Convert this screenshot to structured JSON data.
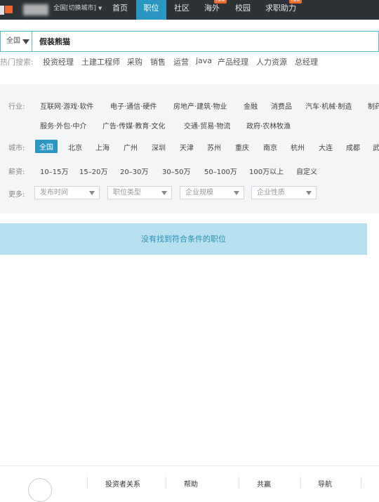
{
  "header": {
    "city_switch": "全国[切换城市]",
    "nav": [
      {
        "label": "首页"
      },
      {
        "label": "职位"
      },
      {
        "label": "社区"
      },
      {
        "label": "海外",
        "badge": "new"
      },
      {
        "label": "校园"
      },
      {
        "label": "求职助力",
        "badge": "new"
      }
    ],
    "active_nav": "职位",
    "accent_color": "#2a97c2",
    "badge_color": "#f06a2c"
  },
  "search": {
    "scope_label": "全国",
    "query": "假装熊猫"
  },
  "hot_search": {
    "label": "热门搜索:",
    "keywords": [
      "投资经理",
      "土建工程师",
      "采购",
      "销售",
      "运营",
      "java",
      "产品经理",
      "人力资源",
      "总经理"
    ]
  },
  "filters": {
    "industry": {
      "label": "行业:",
      "options": [
        "互联网·游戏·软件",
        "电子·通信·硬件",
        "房地产·建筑·物业",
        "金融",
        "消费品",
        "汽车·机械·制造",
        "制药",
        "服务·外包·中介",
        "广告·传媒·教育·文化",
        "交通·贸易·物流",
        "政府·农林牧渔"
      ]
    },
    "city": {
      "label": "城市:",
      "options": [
        "全国",
        "北京",
        "上海",
        "广州",
        "深圳",
        "天津",
        "苏州",
        "重庆",
        "南京",
        "杭州",
        "大连",
        "成都",
        "武"
      ],
      "selected": "全国"
    },
    "salary": {
      "label": "薪资:",
      "options": [
        "10–15万",
        "15–20万",
        "20–30万",
        "30–50万",
        "50–100万",
        "100万以上",
        "自定义"
      ]
    },
    "more": {
      "label": "更多:",
      "dropdowns": [
        "发布时间",
        "职位类型",
        "企业规模",
        "企业性质"
      ]
    }
  },
  "results": {
    "empty_message": "没有找到符合条件的职位"
  },
  "footer": {
    "links": [
      "投资者关系",
      "帮助",
      "共赢",
      "导航"
    ]
  }
}
